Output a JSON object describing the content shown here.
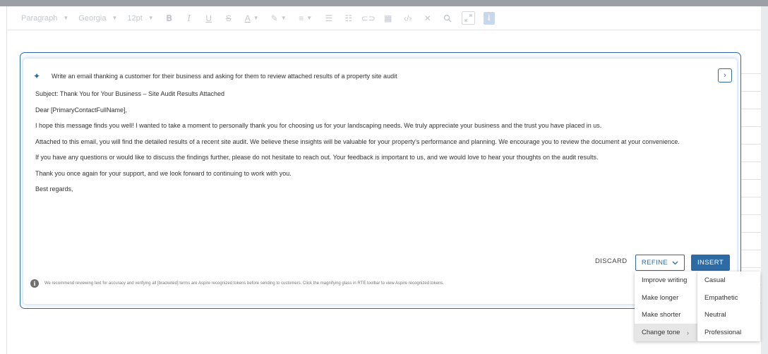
{
  "toolbar": {
    "paragraph": "Paragraph",
    "font": "Georgia",
    "size": "12pt",
    "icons": [
      "bold-icon",
      "italic-icon",
      "underline-icon",
      "strikethrough-icon",
      "font-color-icon",
      "highlight-icon",
      "align-icon",
      "bullet-list-icon",
      "numbered-list-icon",
      "link-icon",
      "table-icon",
      "code-icon",
      "clear-format-icon",
      "search-icon",
      "image-icon",
      "token-icon"
    ]
  },
  "panel": {
    "prompt": "Write an email thanking a customer for their business and asking for them to review attached results of a property site audit",
    "email": {
      "subject": "Subject: Thank You for Your Business – Site Audit Results Attached",
      "greeting": "Dear [PrimaryContactFullName],",
      "p1": "I hope this message finds you well! I wanted to take a moment to personally thank you for choosing us for your landscaping needs. We truly appreciate your business and the trust you have placed in us.",
      "p2": "Attached to this email, you will find the detailed results of a recent site audit. We believe these insights will be valuable for your property's performance and planning. We encourage you to review the document at your convenience.",
      "p3": "If you have any questions or would like to discuss the findings further, please do not hesitate to reach out. Your feedback is important to us, and we would love to hear your thoughts on the audit results.",
      "p4": "Thank you once again for your support, and we look forward to continuing to work with you.",
      "closing": "Best regards,"
    },
    "discard_label": "DISCARD",
    "refine_label": "REFINE",
    "insert_label": "INSERT",
    "disclaimer": "We recommend reviewing text for accuracy and verifying all [bracketed] terms are Aspire recognized tokens before sending to customers. Click the magnifying glass in RTE toolbar to view Aspire recognized tokens."
  },
  "refine_menu": {
    "items": [
      "Improve writing",
      "Make longer",
      "Make shorter",
      "Change tone"
    ],
    "active_index": 3
  },
  "tone_menu": {
    "items": [
      "Casual",
      "Empathetic",
      "Neutral",
      "Professional"
    ]
  },
  "colors": {
    "accent": "#2c6ba5",
    "menu_active": "#e6e6e6"
  }
}
